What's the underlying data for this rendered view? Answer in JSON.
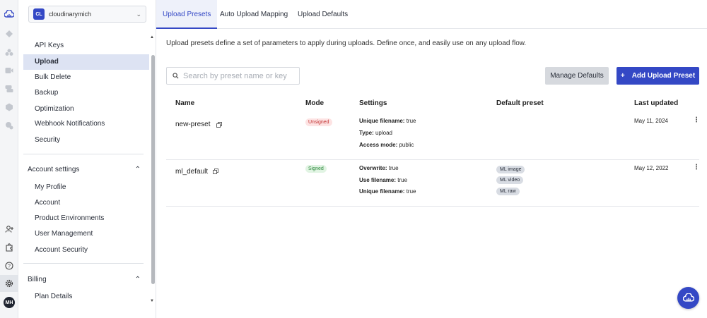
{
  "brand": {
    "accent": "#3448c5"
  },
  "account": {
    "badge": "CL",
    "cloud_name": "cloudinarymich"
  },
  "user": {
    "initials": "MH"
  },
  "sidebar": {
    "items": [
      {
        "label": "API Keys"
      },
      {
        "label": "Upload",
        "active": true
      },
      {
        "label": "Bulk Delete"
      },
      {
        "label": "Backup"
      },
      {
        "label": "Optimization"
      },
      {
        "label": "Webhook Notifications"
      },
      {
        "label": "Security"
      }
    ],
    "account_settings": {
      "title": "Account settings",
      "items": [
        {
          "label": "My Profile"
        },
        {
          "label": "Account"
        },
        {
          "label": "Product Environments"
        },
        {
          "label": "User Management"
        },
        {
          "label": "Account Security"
        }
      ]
    },
    "billing": {
      "title": "Billing",
      "items": [
        {
          "label": "Plan Details"
        }
      ]
    }
  },
  "tabs": [
    {
      "label": "Upload Presets",
      "active": true
    },
    {
      "label": "Auto Upload Mapping"
    },
    {
      "label": "Upload Defaults"
    }
  ],
  "intro": "Upload presets define a set of parameters to apply during uploads. Define once, and easily use on any upload flow.",
  "search": {
    "placeholder": "Search by preset name or key",
    "value": ""
  },
  "buttons": {
    "manage_defaults": "Manage Defaults",
    "add_preset": "Add Upload Preset"
  },
  "table": {
    "columns": [
      "Name",
      "Mode",
      "Settings",
      "Default preset",
      "Last updated"
    ],
    "rows": [
      {
        "name": "new-preset",
        "mode": "Unsigned",
        "settings": [
          {
            "key": "Unique filename:",
            "value": "true"
          },
          {
            "key": "Type:",
            "value": "upload"
          },
          {
            "key": "Access mode:",
            "value": "public"
          }
        ],
        "default_preset": [],
        "last_updated": "May 11, 2024"
      },
      {
        "name": "ml_default",
        "mode": "Signed",
        "settings": [
          {
            "key": "Overwrite:",
            "value": "true"
          },
          {
            "key": "Use filename:",
            "value": "true"
          },
          {
            "key": "Unique filename:",
            "value": "true"
          }
        ],
        "default_preset": [
          "ML image",
          "ML video",
          "ML raw"
        ],
        "last_updated": "May 12, 2022"
      }
    ]
  }
}
